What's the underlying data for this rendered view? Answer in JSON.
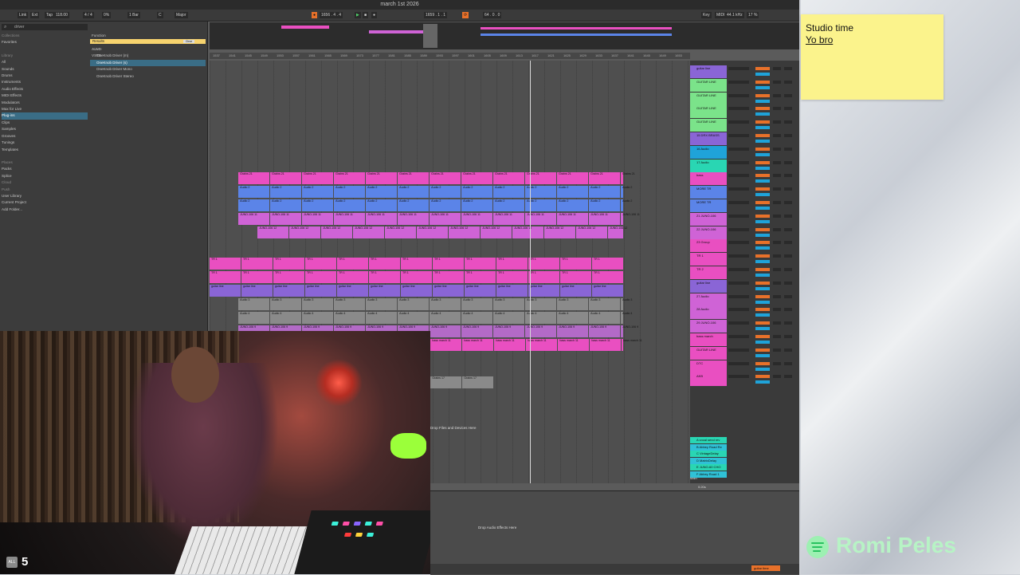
{
  "window": {
    "title": "march 1st 2026"
  },
  "transport": {
    "link": "Link",
    "ext": "Ext",
    "tap": "Tap",
    "tempo": "118.00",
    "signature": "4 / 4",
    "cpu": "0%",
    "quant": "1 Bar",
    "key": "C",
    "scale": "Major",
    "position": "1656 . 4 . 4",
    "loop_start": "1659 . 1 . 1",
    "loop_len": "64 . 0 . 0",
    "key_btn": "Key",
    "midi": "MIDI",
    "sample_rate": "44.1 kHz",
    "cpu_meter": "17 %"
  },
  "browser": {
    "search": "driver",
    "collections_header": "Collections",
    "collections": [
      "Favorites"
    ],
    "library_header": "Library",
    "library": [
      "All",
      "Sounds",
      "Drums",
      "Instruments",
      "Audio Effects",
      "MIDI Effects",
      "Modulators",
      "Max for Live",
      "Plug-ins",
      "Clips",
      "Samples",
      "Grooves",
      "Tunings",
      "Templates"
    ],
    "places_header": "Places",
    "places": [
      "Packs",
      "Splice",
      "Cloud",
      "Push",
      "User Library",
      "Current Project",
      "Add Folder..."
    ],
    "filters": [
      "Function",
      "Format",
      "AUv3",
      "VST3",
      "Creator"
    ],
    "results_label": "Results",
    "clear_label": "Clear",
    "name_header": "Name",
    "files": [
      "OneKnob Driver (m)",
      "OneKnob Driver (s)",
      "OneKnob Driver Mono",
      "OneKnob Driver Stereo"
    ]
  },
  "ruler": [
    "1537",
    "1541",
    "1545",
    "1549",
    "1553",
    "1557",
    "1561",
    "1565",
    "1569",
    "1573",
    "1577",
    "1581",
    "1585",
    "1589",
    "1593",
    "1597",
    "1601",
    "1605",
    "1609",
    "1613",
    "1617",
    "1621",
    "1625",
    "1629",
    "1633",
    "1637",
    "1641",
    "1645",
    "1649",
    "1653"
  ],
  "lanes": [
    {
      "label": "Grains 21",
      "color": "#e94fc1",
      "start": 0.06,
      "end": 0.86
    },
    {
      "label": "Audio 2",
      "color": "#5b84e8",
      "start": 0.06,
      "end": 0.86
    },
    {
      "label": "Audio 2",
      "color": "#5b84e8",
      "start": 0.06,
      "end": 0.86
    },
    {
      "label": "JUNO-106 11",
      "color": "#cf63d6",
      "start": 0.06,
      "end": 0.86
    },
    {
      "label": "JUNO-106 12",
      "color": "#cf63d6",
      "start": 0.1,
      "end": 0.86
    },
    {
      "label": "TR 1",
      "color": "#e94fc1",
      "start": 0.0,
      "end": 0.86
    },
    {
      "label": "TR 1",
      "color": "#e94fc1",
      "start": 0.0,
      "end": 0.86
    },
    {
      "label": "guitar line",
      "color": "#8a65d6",
      "start": 0.0,
      "end": 0.86
    },
    {
      "label": "Audio 3",
      "color": "#8a8a8a",
      "start": 0.06,
      "end": 0.86
    },
    {
      "label": "Audio 4",
      "color": "#8a8a8a",
      "start": 0.06,
      "end": 0.86
    },
    {
      "label": "JUNO-106 9",
      "color": "#b36ac7",
      "start": 0.06,
      "end": 0.86
    },
    {
      "label": "bass march 11",
      "color": "#e94fc1",
      "start": 0.46,
      "end": 0.86
    },
    {
      "label": "Grains 17",
      "color": "#8a8a8a",
      "start": 0.46,
      "end": 0.59
    }
  ],
  "tracks": [
    {
      "name": "guitar line",
      "color": "#8a65d6"
    },
    {
      "name": "GUITAR LINE",
      "color": "#7be38a"
    },
    {
      "name": "GUITAR LINE",
      "color": "#7be38a"
    },
    {
      "name": "GUITAR LINE",
      "color": "#7be38a"
    },
    {
      "name": "GUITAR LINE",
      "color": "#7be38a"
    },
    {
      "name": "15 DRX BRASS",
      "color": "#8a65d6"
    },
    {
      "name": "16 Audio",
      "color": "#1fa3d9"
    },
    {
      "name": "17 Audio",
      "color": "#29d6b3"
    },
    {
      "name": "bass",
      "color": "#e94fc1"
    },
    {
      "name": "MORE TR",
      "color": "#5b84e8"
    },
    {
      "name": "MORE TR",
      "color": "#5b84e8"
    },
    {
      "name": "21 JUNO-106",
      "color": "#cf63d6"
    },
    {
      "name": "22 JUNO-106",
      "color": "#cf63d6"
    },
    {
      "name": "23 Group",
      "color": "#e94fc1"
    },
    {
      "name": "TR 1",
      "color": "#e94fc1"
    },
    {
      "name": "TR 2",
      "color": "#e94fc1"
    },
    {
      "name": "guitar line",
      "color": "#8a65d6"
    },
    {
      "name": "27 Audio",
      "color": "#cf63d6"
    },
    {
      "name": "28 Audio",
      "color": "#cf63d6"
    },
    {
      "name": "29 JUNO-106",
      "color": "#cf63d6"
    },
    {
      "name": "bass march",
      "color": "#e94fc1"
    },
    {
      "name": "GUITAR LINE",
      "color": "#e94fc1"
    },
    {
      "name": "DTC",
      "color": "#e94fc1"
    },
    {
      "name": "AKB",
      "color": "#e94fc1"
    }
  ],
  "returns": [
    "A vocal send rev",
    "B Abbey Road Re",
    "C VintageDelay",
    "D MatrixDelay",
    "E JUNO-60 CHO",
    "F Abbey Road 1"
  ],
  "master": {
    "name": "Main",
    "time": "0:20s"
  },
  "drop_labels": {
    "files": "Drop Files and Devices Here",
    "effects": "Drop Audio Effects Here"
  },
  "bottom": {
    "track": "guitar time"
  },
  "sticky": {
    "line1": "Studio time",
    "line2": "Yo bro"
  },
  "overlay": {
    "name": "Romi Peles",
    "badge": "ALL",
    "count": "5"
  }
}
